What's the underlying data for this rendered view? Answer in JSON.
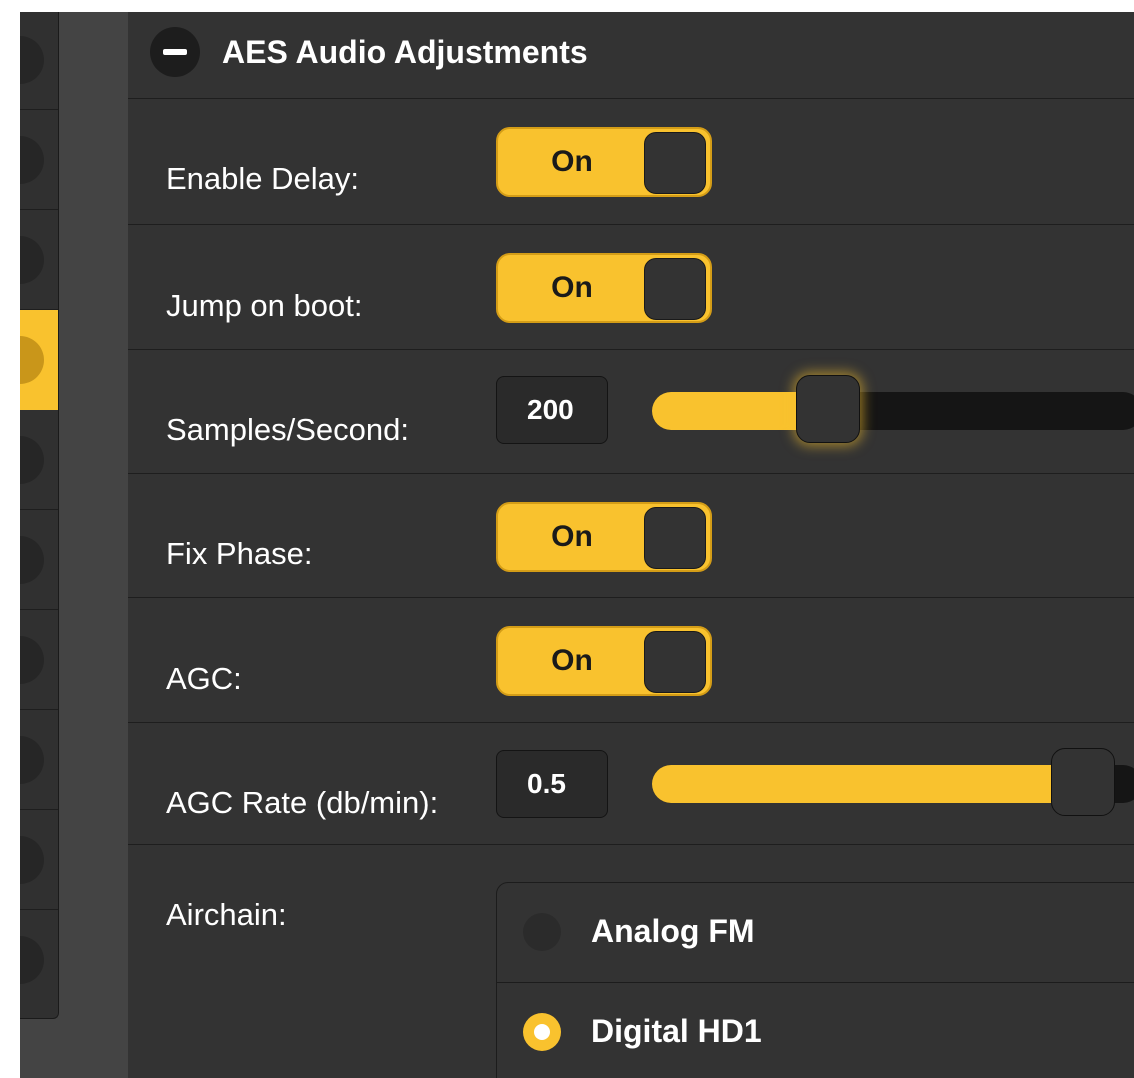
{
  "panel": {
    "title": "AES Audio Adjustments"
  },
  "settings": {
    "enable_delay": {
      "label": "Enable Delay:",
      "state": "On"
    },
    "jump_on_boot": {
      "label": "Jump on boot:",
      "state": "On"
    },
    "samples_per_second": {
      "label": "Samples/Second:",
      "value": "200",
      "slider_fill_fraction": 0.36
    },
    "fix_phase": {
      "label": "Fix Phase:",
      "state": "On"
    },
    "agc": {
      "label": "AGC:",
      "state": "On"
    },
    "agc_rate": {
      "label": "AGC Rate (db/min):",
      "value": "0.5",
      "slider_fill_fraction": 0.88
    },
    "airchain": {
      "label": "Airchain:",
      "options": [
        {
          "label": "Analog FM",
          "selected": false
        },
        {
          "label": "Digital HD1",
          "selected": true
        }
      ]
    }
  },
  "colors": {
    "accent": "#f9c22e",
    "panel_bg": "#333333",
    "text": "#ffffff"
  },
  "icons": {
    "collapse": "minus-icon"
  }
}
